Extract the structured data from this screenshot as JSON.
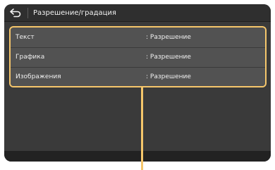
{
  "header": {
    "title": "Разрешение/градация",
    "back_icon": "back-arrow-icon"
  },
  "colors": {
    "highlight": "#f5c66b",
    "background": "#3a3a3a",
    "row": "#525252",
    "text": "#f0f0f0"
  },
  "rows": [
    {
      "label": "Текст",
      "value": ": Разрешение"
    },
    {
      "label": "Графика",
      "value": ": Разрешение"
    },
    {
      "label": "Изображения",
      "value": ": Разрешение"
    }
  ]
}
